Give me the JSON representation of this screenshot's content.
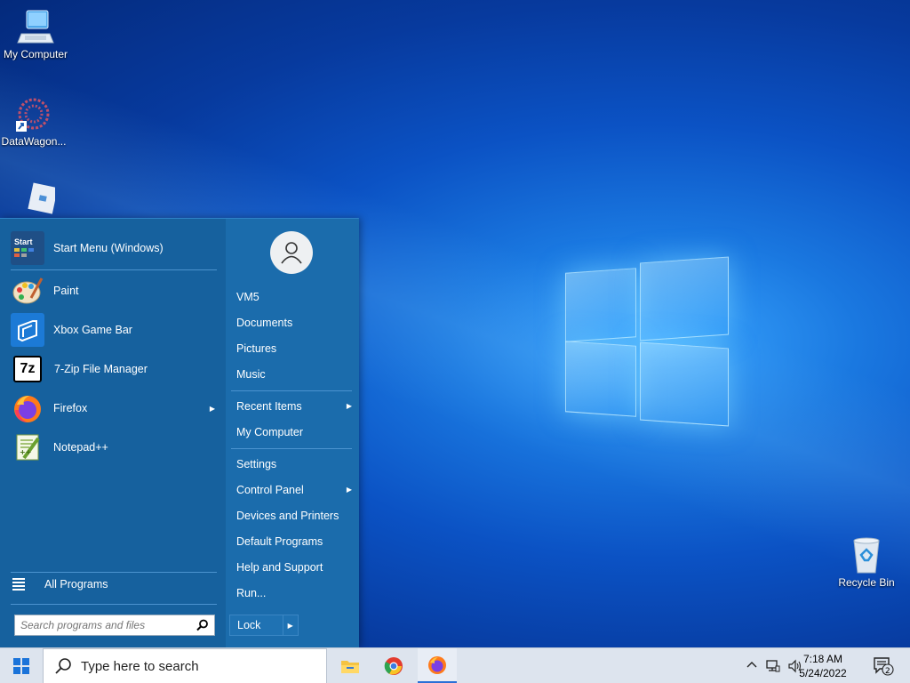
{
  "desktop": {
    "icons": [
      {
        "label": "My Computer"
      },
      {
        "label": "DataWagon..."
      },
      {
        "label": "Recycle Bin"
      }
    ]
  },
  "start_menu": {
    "pinned": [
      {
        "label": "Start Menu (Windows)",
        "icon": "start-menu-icon"
      },
      {
        "label": "Paint",
        "icon": "paint-icon"
      },
      {
        "label": "Xbox Game Bar",
        "icon": "xbox-icon"
      },
      {
        "label": "7-Zip File Manager",
        "icon": "7zip-icon",
        "icon_text": "7z"
      },
      {
        "label": "Firefox",
        "icon": "firefox-icon",
        "has_submenu": true
      },
      {
        "label": "Notepad++",
        "icon": "notepadpp-icon"
      }
    ],
    "start_icon_text": "Start",
    "all_programs": "All Programs",
    "search_placeholder": "Search programs and files",
    "right": {
      "user": "VM5",
      "items_group1": [
        "Documents",
        "Pictures",
        "Music"
      ],
      "items_group2": [
        {
          "label": "Recent Items",
          "has_submenu": true
        },
        {
          "label": "My Computer",
          "has_submenu": false
        }
      ],
      "items_group3": [
        {
          "label": "Settings",
          "has_submenu": false
        },
        {
          "label": "Control Panel",
          "has_submenu": true
        },
        {
          "label": "Devices and Printers",
          "has_submenu": false
        },
        {
          "label": "Default Programs",
          "has_submenu": false
        },
        {
          "label": "Help and Support",
          "has_submenu": false
        },
        {
          "label": "Run...",
          "has_submenu": false
        }
      ],
      "lock": "Lock"
    }
  },
  "taskbar": {
    "search_text": "Type here to search",
    "apps": [
      "file-explorer-icon",
      "chrome-icon",
      "firefox-icon"
    ],
    "time": "7:18 AM",
    "date": "5/24/2022",
    "notification_count": "2"
  },
  "colors": {
    "start_menu_bg": "#1565a8",
    "taskbar_bg": "#dde4ee",
    "accent": "#2a6fd6"
  }
}
